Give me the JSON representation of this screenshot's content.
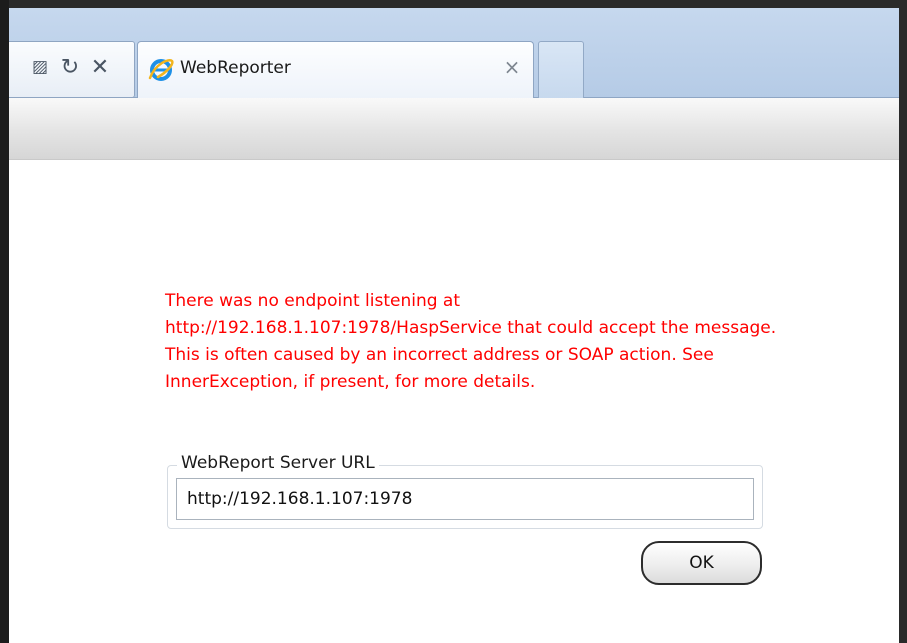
{
  "browser": {
    "tab_title": "WebReporter",
    "tab_close_glyph": "×",
    "icons": {
      "compatibility": "compatibility-view-icon",
      "refresh": "refresh-icon",
      "stop": "stop-icon",
      "favicon": "internet-explorer-icon"
    },
    "accent_color": "#b5cbe6"
  },
  "page": {
    "error_message": "There was no endpoint listening at http://192.168.1.107:1978/HaspService that could accept the message. This is often caused by an incorrect address or SOAP action. See InnerException, if present, for more details.",
    "error_color": "#ff0000",
    "server_group_label": "WebReport Server URL",
    "server_url_value": "http://192.168.1.107:1978",
    "ok_label": "OK"
  }
}
